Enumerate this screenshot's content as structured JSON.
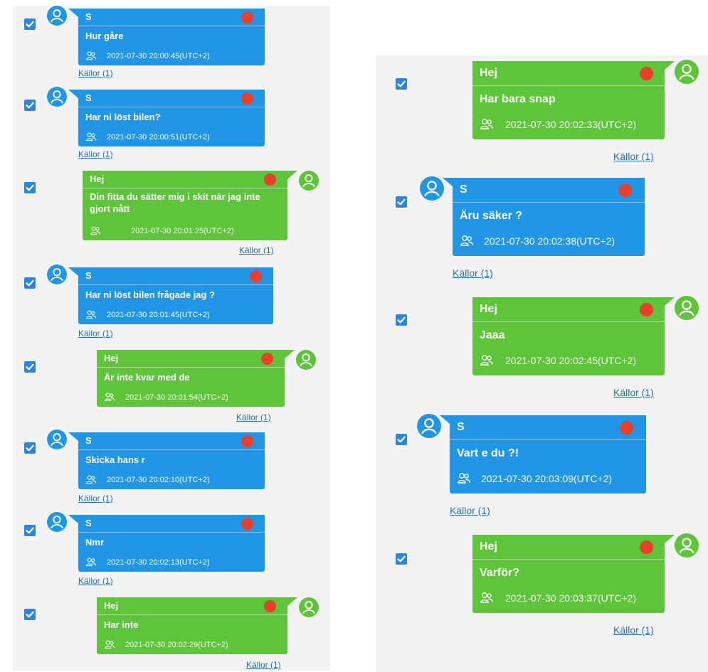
{
  "colors": {
    "incoming": "#2196e6",
    "outgoing": "#5ec43a",
    "status_dot": "#e8402a",
    "link": "#2a6fb8"
  },
  "sources_label": "Källor (1)",
  "messages": [
    {
      "sender": "S",
      "text": "Hur gåre",
      "timestamp": "2021-07-30 20:00:45(UTC+2)"
    },
    {
      "sender": "S",
      "text": "Har ni löst bilen?",
      "timestamp": "2021-07-30 20:00:51(UTC+2)"
    },
    {
      "sender": "Hej",
      "text": "Din fitta du sätter mig i skit när jag inte gjort nått",
      "timestamp": "2021-07-30 20:01:25(UTC+2)"
    },
    {
      "sender": "S",
      "text": "Har ni löst bilen frågade jag ?",
      "timestamp": "2021-07-30 20:01:45(UTC+2)"
    },
    {
      "sender": "Hej",
      "text": "Är inte kvar med de",
      "timestamp": "2021-07-30 20:01:54(UTC+2)"
    },
    {
      "sender": "S",
      "text": "Skicka hans r",
      "timestamp": "2021-07-30 20:02:10(UTC+2)"
    },
    {
      "sender": "S",
      "text": "Nmr",
      "timestamp": "2021-07-30 20:02:13(UTC+2)"
    },
    {
      "sender": "Hej",
      "text": "Har inte",
      "timestamp": "2021-07-30 20:02:29(UTC+2)"
    },
    {
      "sender": "Hej",
      "text": "Har bara snap",
      "timestamp": "2021-07-30 20:02:33(UTC+2)"
    },
    {
      "sender": "S",
      "text": "Äru säker ?",
      "timestamp": "2021-07-30 20:02:38(UTC+2)"
    },
    {
      "sender": "Hej",
      "text": "Jaaa",
      "timestamp": "2021-07-30 20:02:45(UTC+2)"
    },
    {
      "sender": "S",
      "text": "Vart e du ?!",
      "timestamp": "2021-07-30 20:03:09(UTC+2)"
    },
    {
      "sender": "Hej",
      "text": "Varför?",
      "timestamp": "2021-07-30 20:03:37(UTC+2)"
    }
  ]
}
